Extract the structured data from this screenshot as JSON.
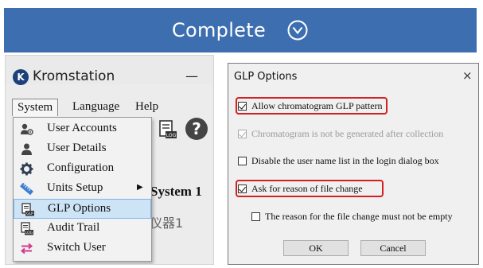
{
  "banner": {
    "title": "Complete",
    "icon": "chevron-down-circle-icon",
    "background_color": "#3d6fb0"
  },
  "left_window": {
    "app_title": "Kromstation",
    "logo_letter": "K",
    "minimize_glyph": "—",
    "menubar": {
      "items": [
        {
          "label": "System",
          "active": true
        },
        {
          "label": "Language",
          "active": false
        },
        {
          "label": "Help",
          "active": false
        }
      ]
    },
    "help_glyph": "?",
    "background_text": {
      "system_label": "System 1",
      "instrument_label": "仪器1"
    },
    "dropdown": {
      "items": [
        {
          "label": "User Accounts",
          "icon": "user-accounts-icon"
        },
        {
          "label": "User Details",
          "icon": "user-icon"
        },
        {
          "label": "Configuration",
          "icon": "gear-icon"
        },
        {
          "label": "Units Setup",
          "icon": "ruler-icon",
          "submenu": true
        },
        {
          "label": "GLP Options",
          "icon": "glp-document-icon",
          "selected": true
        },
        {
          "label": "Audit Trail",
          "icon": "log-document-icon"
        },
        {
          "label": "Switch User",
          "icon": "switch-arrows-icon"
        }
      ],
      "submenu_arrow": "▶"
    }
  },
  "dialog": {
    "title": "GLP Options",
    "close_glyph": "×",
    "options": [
      {
        "label": "Allow chromatogram GLP pattern",
        "checked": true,
        "disabled": false,
        "highlighted": true
      },
      {
        "label": "Chromatogram is not be generated after collection",
        "checked": true,
        "disabled": true,
        "highlighted": false
      },
      {
        "label": "Disable the user name list in the login dialog box",
        "checked": false,
        "disabled": false,
        "highlighted": false
      },
      {
        "label": "Ask for reason of file change",
        "checked": true,
        "disabled": false,
        "highlighted": true
      },
      {
        "label": "The reason for the file change must not be empty",
        "checked": false,
        "disabled": false,
        "highlighted": false
      }
    ],
    "ok_label": "OK",
    "cancel_label": "Cancel",
    "highlight_color": "#d42020"
  }
}
